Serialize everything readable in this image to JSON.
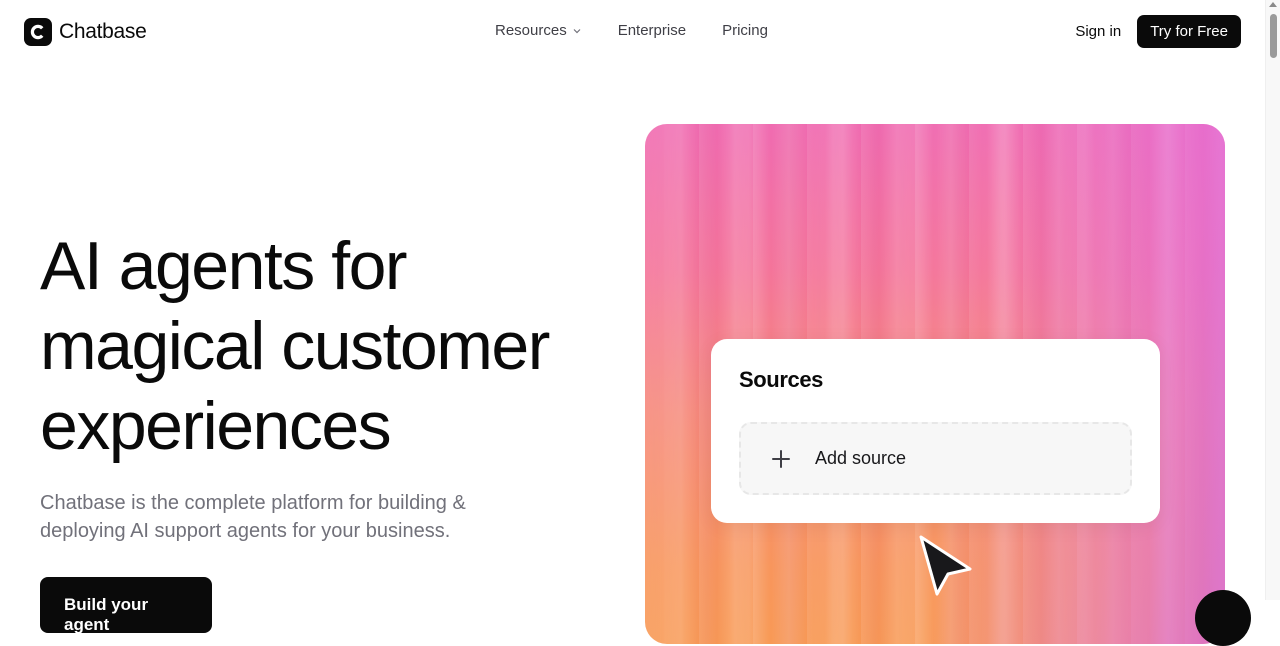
{
  "brand": {
    "name": "Chatbase"
  },
  "nav": {
    "items": [
      {
        "label": "Resources",
        "has_dropdown": true
      },
      {
        "label": "Enterprise"
      },
      {
        "label": "Pricing"
      }
    ]
  },
  "header": {
    "signin_label": "Sign in",
    "cta_label": "Try for Free"
  },
  "hero": {
    "title_lines": [
      "AI agents for",
      "magical customer",
      "experiences"
    ],
    "subtitle_lines": [
      "Chatbase is the complete platform for building &",
      "deploying AI support agents for your business."
    ],
    "cta_label": "Build your agent"
  },
  "visual": {
    "card_title": "Sources",
    "add_label": "Add source"
  },
  "colors": {
    "primary": "#0a0a0a",
    "muted_text": "#71717a",
    "gradient_pink": "#f06bb1",
    "gradient_orange": "#f89a55",
    "gradient_purple": "#d264eb"
  },
  "icons": [
    "chatbase-logo-icon",
    "chevron-down-icon",
    "plus-icon",
    "cursor-arrow-icon",
    "chat-bubble-icon"
  ]
}
